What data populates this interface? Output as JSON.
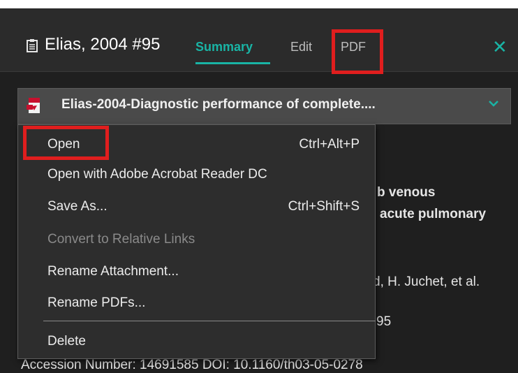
{
  "header": {
    "reference_title": "Elias, 2004 #95",
    "tabs": [
      {
        "label": "Summary",
        "active": true
      },
      {
        "label": "Edit",
        "active": false
      },
      {
        "label": "PDF",
        "active": false
      }
    ],
    "close_icon": "close-icon",
    "reference_icon": "clipboard-icon",
    "accent_color": "#19b4a5",
    "highlight_color": "#e01e1e"
  },
  "attachment": {
    "filename": "Elias-2004-Diagnostic performance of complete....",
    "icon": "pdf-file-icon",
    "dropdown_icon": "chevron-down-icon"
  },
  "background_summary": {
    "title_line1_fragment": "b venous",
    "title_line2_fragment": "acute pulmonary",
    "authors_fragment": "d, H. Juchet, et al.",
    "pages_fragment": "95",
    "accession_line": "Accession Number: 14691585 DOI: 10.1160/th03-05-0278"
  },
  "context_menu": {
    "items": [
      {
        "label": "Open",
        "shortcut": "Ctrl+Alt+P",
        "enabled": true
      },
      {
        "label": "Open with Adobe Acrobat Reader DC",
        "shortcut": "",
        "enabled": true
      },
      {
        "label": "Save As...",
        "shortcut": "Ctrl+Shift+S",
        "enabled": true
      },
      {
        "label": "Convert to Relative Links",
        "shortcut": "",
        "enabled": false
      },
      {
        "label": "Rename Attachment...",
        "shortcut": "",
        "enabled": true
      },
      {
        "label": "Rename PDFs...",
        "shortcut": "",
        "enabled": true
      },
      {
        "label": "Delete",
        "shortcut": "",
        "enabled": true
      }
    ]
  }
}
